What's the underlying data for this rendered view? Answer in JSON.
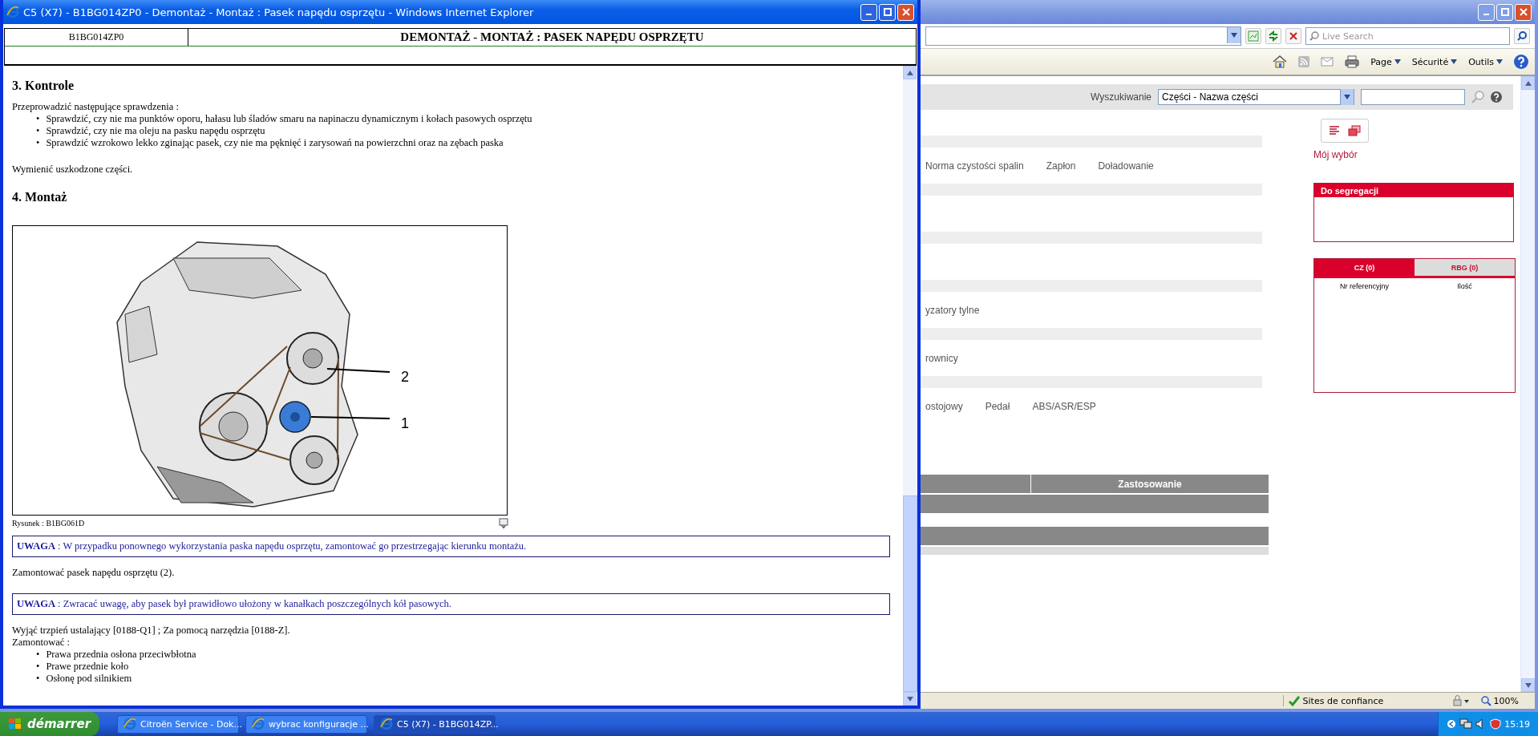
{
  "background_window": {
    "search_placeholder": "Live Search",
    "command_menus": [
      "Page",
      "Sécurité",
      "Outils"
    ],
    "search_label": "Wyszukiwanie",
    "search_select": "Części - Nazwa części",
    "my_selection": "Mój wybór",
    "category_groups": [
      {
        "items": [
          "Norma czystości spalin",
          "Zapłon",
          "Doładowanie"
        ]
      },
      {
        "items": [
          "yzatory tylne"
        ]
      },
      {
        "items": [
          "rownicy"
        ]
      },
      {
        "items": [
          "ostojowy",
          "Pedał",
          "ABS/ASR/ESP"
        ]
      }
    ],
    "table_header": "Zastosowanie",
    "sort_panel_title": "Do segregacji",
    "tabs": [
      {
        "label": "CZ (0)",
        "selected": true
      },
      {
        "label": "RBG (0)",
        "selected": false
      }
    ],
    "columns": [
      "Nr referencyjny",
      "Ilość"
    ],
    "status_zone": "Sites de confiance",
    "status_zoom": "100%"
  },
  "popup_window": {
    "title": "C5 (X7) - B1BG014ZP0 - Demontaż - Montaż : Pasek napędu osprzętu - Windows Internet Explorer",
    "document_code": "B1BG014ZP0",
    "document_title": "DEMONTAŻ - MONTAŻ : PASEK NAPĘDU OSPRZĘTU",
    "blocks": [
      {
        "kind": "heading",
        "text": "3. Kontrole"
      },
      {
        "kind": "paragraph",
        "lines": [
          "Przeprowadzić następujące sprawdzenia :"
        ],
        "marker": "•",
        "bullets": [
          "Sprawdzić, czy nie ma punktów oporu, hałasu lub śladów smaru na napinaczu dynamicznym i kołach pasowych osprzętu",
          "Sprawdzić, czy nie ma oleju na pasku napędu osprzętu",
          "Sprawdzić wzrokowo lekko zginając pasek, czy nie ma pęknięć i zarysowań na powierzchni oraz na zębach paska"
        ]
      },
      {
        "kind": "paragraph",
        "lines": [
          "Wymienić uszkodzone części."
        ]
      },
      {
        "kind": "heading",
        "text": "4. Montaż"
      },
      {
        "kind": "figure",
        "callouts": [
          "2",
          "1"
        ],
        "caption": "Rysunek : B1BG061D"
      },
      {
        "kind": "note",
        "text": "**UWAGA** : W przypadku ponownego wykorzystania paska napędu osprzętu, zamontować go przestrzegając kierunku montażu."
      },
      {
        "kind": "paragraph",
        "lines": [
          "Zamontować pasek napędu osprzętu (2)."
        ]
      },
      {
        "kind": "note",
        "text": "**UWAGA** : Zwracać uwagę, aby pasek był prawidłowo ułożony w kanałkach poszczególnych kół pasowych."
      },
      {
        "kind": "paragraph",
        "lines": [
          "Wyjąć trzpień ustalający [0188-Q1] ; Za pomocą narzędzia [0188-Z].",
          "Zamontować :"
        ],
        "marker": "•",
        "bullets": [
          "Prawa przednia osłona przeciwbłotna",
          "Prawe przednie koło",
          "Osłonę pod silnikiem"
        ]
      }
    ]
  },
  "taskbar": {
    "start": "démarrer",
    "tasks": [
      {
        "label": "Citroën Service - Dok...",
        "selected": false
      },
      {
        "label": "wybrac konfiguracje ...",
        "selected": false
      },
      {
        "label": "C5 (X7) - B1BG014ZP...",
        "selected": true
      }
    ],
    "clock": "15:19"
  }
}
